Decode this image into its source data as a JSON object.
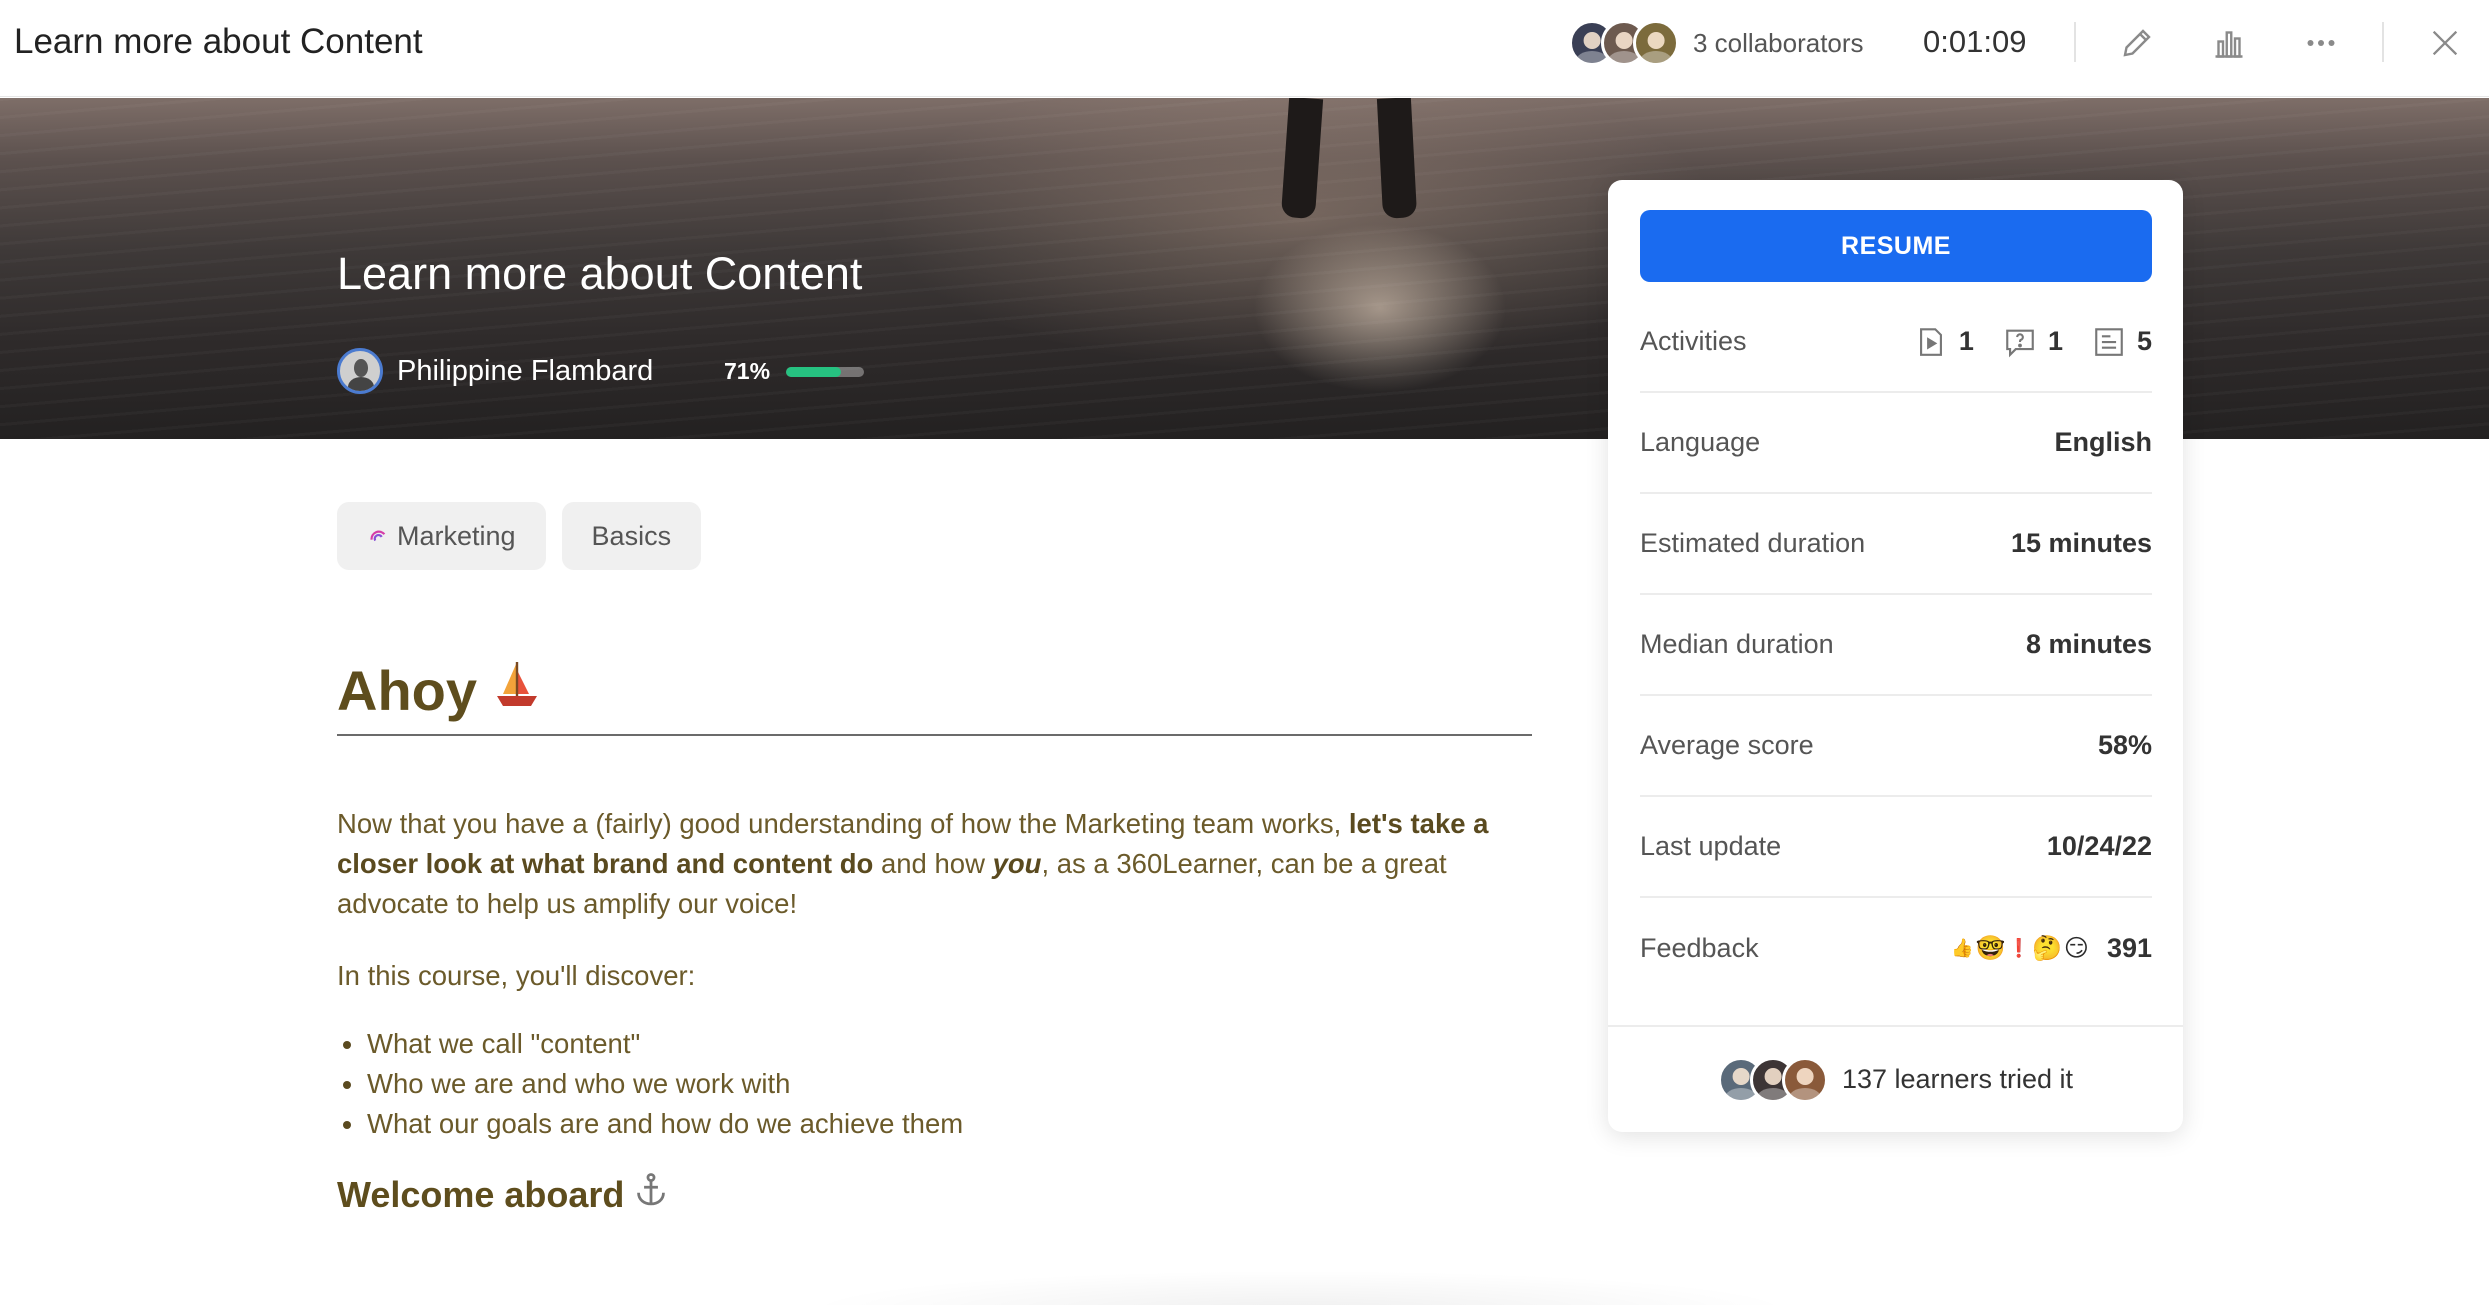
{
  "topbar": {
    "title": "Learn more about Content",
    "collaborators_label": "3 collaborators",
    "timer": "0:01:09",
    "icons": [
      "edit-icon",
      "stats-icon",
      "more-icon",
      "close-icon"
    ]
  },
  "hero": {
    "title": "Learn more about Content",
    "author": "Philippine Flambard",
    "progress_label": "71%",
    "progress_value": 0.71
  },
  "tags": [
    {
      "label": "Marketing",
      "icon": "marketing-icon"
    },
    {
      "label": "Basics"
    }
  ],
  "content": {
    "heading": "Ahoy",
    "heading_emoji": "⛵",
    "para_1a": "Now that you have a (fairly) good understanding of how the Marketing team works, ",
    "para_1b": "let's take a closer look at what brand and content do",
    "para_1c": " and how ",
    "para_1d": "you",
    "para_1e": ", as a 360Learner, can be a great advocate to help us amplify our voice!",
    "para_2": "In this course, you'll discover:",
    "list": [
      "What we call \"content\"",
      "Who we are and who we work with",
      "What our goals are and how do we achieve them"
    ],
    "subheading": "Welcome aboard",
    "subheading_emoji": "⚓"
  },
  "card": {
    "resume_label": "RESUME",
    "activities_label": "Activities",
    "activities": [
      {
        "icon": "video-icon",
        "count": "1"
      },
      {
        "icon": "question-icon",
        "count": "1"
      },
      {
        "icon": "text-icon",
        "count": "5"
      }
    ],
    "rows": [
      {
        "key": "Language",
        "value": "English"
      },
      {
        "key": "Estimated duration",
        "value": "15 minutes"
      },
      {
        "key": "Median duration",
        "value": "8 minutes"
      },
      {
        "key": "Average score",
        "value": "58%"
      },
      {
        "key": "Last update",
        "value": "10/24/22"
      }
    ],
    "feedback_label": "Feedback",
    "feedback_emojis": [
      "👍",
      "🤓",
      "❗",
      "🤔",
      "😏"
    ],
    "feedback_count": "391",
    "learners_label": "137 learners tried it"
  },
  "colors": {
    "accent": "#1a6bf0",
    "progress": "#26c281",
    "content_text": "#6b5a2a"
  }
}
